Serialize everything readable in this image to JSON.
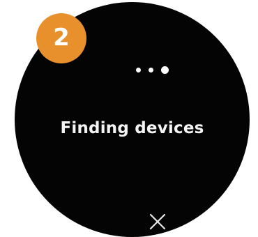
{
  "step_badge": {
    "number": "2",
    "color": "#e8912c"
  },
  "progress": {
    "dot_count": 3,
    "active_index": 2
  },
  "status": {
    "text": "Finding devices"
  },
  "controls": {
    "close_icon": "close-icon"
  },
  "colors": {
    "screen_background": "#040404",
    "foreground": "#ffffff"
  }
}
